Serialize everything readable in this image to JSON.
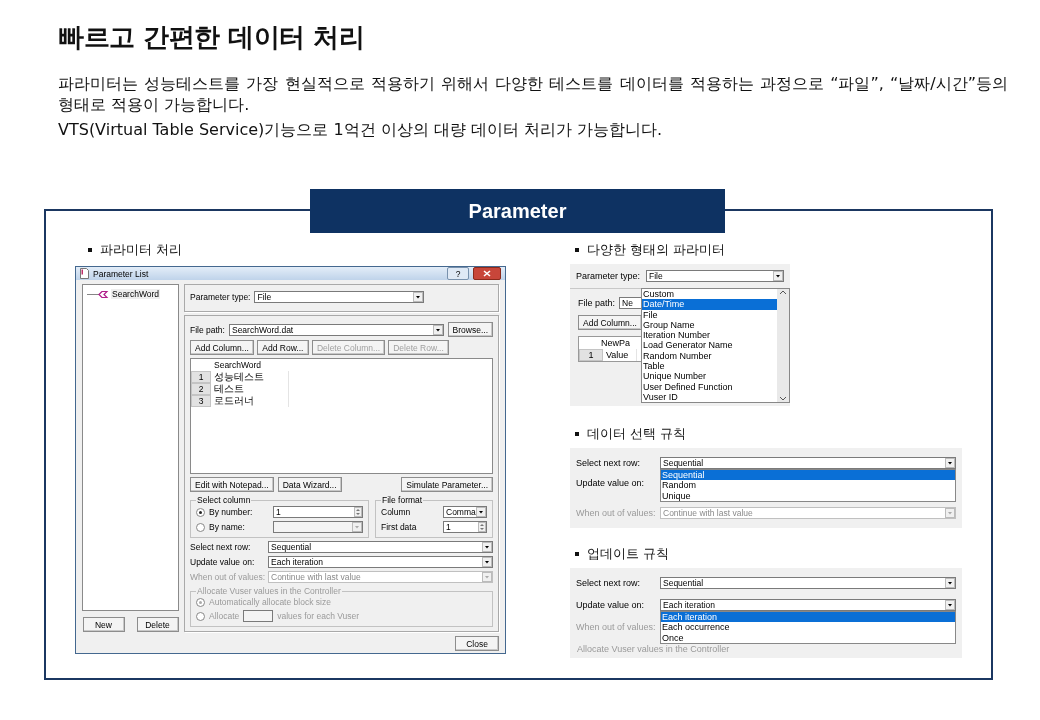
{
  "title": "빠르고 간편한 데이터 처리",
  "paragraphs": [
    "파라미터는 성능테스트를 가장 현실적으로 적용하기 위해서 다양한 테스트를 데이터를 적용하는 과정으로 “파일”, “날짜/시간”등의 형태로 적용이 가능합니다.",
    "VTS(Virtual Table Service)기능으로  1억건 이상의 대량 데이터 처리가 가능합니다."
  ],
  "panel": {
    "title": "Parameter"
  },
  "left": {
    "heading": "파라미터 처리",
    "dialog": {
      "window_title": "Parameter List",
      "help_button": "?",
      "tree": [
        {
          "label": "SearchWord"
        }
      ],
      "tree_buttons": [
        "New",
        "Delete"
      ],
      "parameter_type": {
        "label": "Parameter type:",
        "value": "File"
      },
      "file_path": {
        "label": "File path:",
        "value": "SearchWord.dat",
        "button": "Browse..."
      },
      "column_buttons": [
        {
          "label": "Add Column...",
          "disabled": false
        },
        {
          "label": "Add Row...",
          "disabled": false
        },
        {
          "label": "Delete Column...",
          "disabled": true
        },
        {
          "label": "Delete Row...",
          "disabled": true
        }
      ],
      "grid": {
        "column": "SearchWord",
        "rows": [
          {
            "number": "1",
            "value": "성능테스트"
          },
          {
            "number": "2",
            "value": "테스트"
          },
          {
            "number": "3",
            "value": "로드러너"
          }
        ]
      },
      "tool_buttons": [
        "Edit with Notepad...",
        "Data Wizard...",
        "Simulate Parameter..."
      ],
      "select_column": {
        "title": "Select column",
        "options": [
          {
            "label": "By number:",
            "selected": true,
            "value": "1"
          },
          {
            "label": "By name:",
            "selected": false
          }
        ]
      },
      "file_format": {
        "title": "File format",
        "column_label": "Column",
        "column_value": "Comma",
        "first_label": "First data",
        "first_value": "1"
      },
      "rules": [
        {
          "label": "Select next row:",
          "value": "Sequential",
          "disabled": false
        },
        {
          "label": "Update value on:",
          "value": "Each iteration",
          "disabled": false
        },
        {
          "label": "When out of values:",
          "value": "Continue with last value",
          "disabled": true
        }
      ],
      "allocate": {
        "title": "Allocate Vuser values in the Controller",
        "disabled": true,
        "options": [
          {
            "label": "Automatically allocate block size",
            "selected": true
          },
          {
            "label": "Allocate",
            "selected": false,
            "suffix": "values for each Vuser"
          }
        ]
      },
      "close_button": "Close"
    }
  },
  "right": [
    {
      "kind": "type_list",
      "heading": "다양한 형태의 파라미터",
      "type_label": "Parameter type:",
      "type_value": "File",
      "file_path_label": "File path:",
      "file_path_value": "Ne",
      "add_column": "Add Column...",
      "grid_column": "NewPa",
      "row_number": "1",
      "row_value": "Value",
      "options": [
        {
          "label": "Custom",
          "selected": false
        },
        {
          "label": "Date/Time",
          "selected": true
        },
        {
          "label": "File",
          "selected": false
        },
        {
          "label": "Group Name",
          "selected": false
        },
        {
          "label": "Iteration Number",
          "selected": false
        },
        {
          "label": "Load Generator Name",
          "selected": false
        },
        {
          "label": "Random Number",
          "selected": false
        },
        {
          "label": "Table",
          "selected": false
        },
        {
          "label": "Unique Number",
          "selected": false
        },
        {
          "label": "User Defined Function",
          "selected": false
        },
        {
          "label": "Vuser ID",
          "selected": false
        }
      ]
    },
    {
      "kind": "rules",
      "heading": "데이터 선택 규칙",
      "rows": [
        {
          "label": "Select next row:",
          "value": "Sequential",
          "disabled": false,
          "options": [
            {
              "label": "Sequential",
              "selected": true
            },
            {
              "label": "Random",
              "selected": false
            },
            {
              "label": "Unique",
              "selected": false
            }
          ]
        },
        {
          "label": "Update value on:",
          "disabled": false
        },
        {
          "label": "When out of values:",
          "value": "Continue with last value",
          "disabled": true
        }
      ]
    },
    {
      "kind": "rules",
      "heading": "업데이트 규칙",
      "rows": [
        {
          "label": "Select next row:",
          "value": "Sequential",
          "disabled": false
        },
        {
          "label": "Update value on:",
          "value": "Each iteration",
          "disabled": false,
          "options": [
            {
              "label": "Each iteration",
              "selected": true
            },
            {
              "label": "Each occurrence",
              "selected": false
            },
            {
              "label": "Once",
              "selected": false
            }
          ]
        },
        {
          "label": "When out of values:",
          "disabled": true
        }
      ],
      "group_title": "Allocate Vuser values in the Controller"
    }
  ]
}
